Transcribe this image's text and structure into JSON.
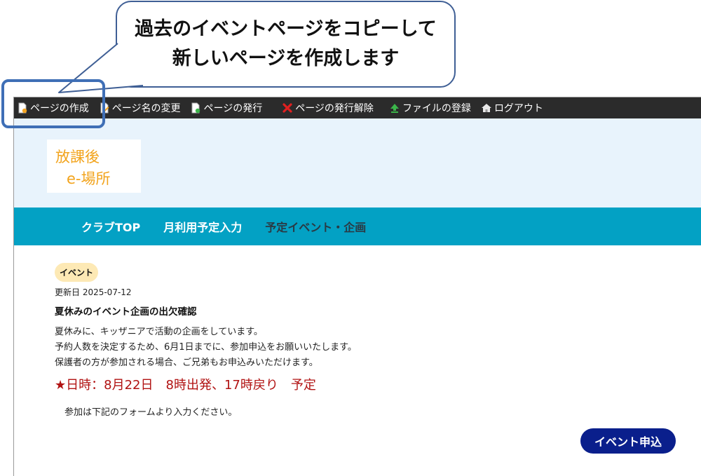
{
  "callout": {
    "line1": "過去のイベントページをコピーして",
    "line2": "新しいページを作成します"
  },
  "toolbar": {
    "items": [
      {
        "label": "ページの作成",
        "icon": "page-add-icon"
      },
      {
        "label": "ページ名の変更",
        "icon": "page-edit-icon"
      },
      {
        "label": "ページの発行",
        "icon": "page-publish-icon"
      },
      {
        "label": "ページの発行解除",
        "icon": "red-x-icon"
      },
      {
        "label": "ファイルの登録",
        "icon": "upload-arrow-icon"
      },
      {
        "label": "ログアウト",
        "icon": "home-icon"
      }
    ]
  },
  "logo": {
    "line1": "放課後",
    "line2": "e-場所"
  },
  "nav": {
    "items": [
      {
        "label": "クラブTOP"
      },
      {
        "label": "月利用予定入力"
      },
      {
        "label": "予定イベント・企画"
      }
    ]
  },
  "article": {
    "badge": "イベント",
    "date": "更新日 2025-07-12",
    "title": "夏休みのイベント企画の出欠確認",
    "body": [
      "夏休みに、キッザニアで活動の企画をしています。",
      "予約人数を決定するため、6月1日までに、参加申込をお願いいたします。",
      "保護者の方が参加される場合、ご兄弟もお申込みいただけます。"
    ],
    "highlight": "★日時：8月22日　8時出発、17時戻り　予定",
    "note": "参加は下記のフォームより入力ください。"
  },
  "apply_button": {
    "label": "イベント申込"
  },
  "colors": {
    "toolbar_bg": "#2b2b2b",
    "hero_bg": "#e8f3fc",
    "nav_bg": "#03a1c4",
    "nav_active": "#ffffff",
    "nav_inactive": "#2a3a44",
    "badge_bg": "#fde9b5",
    "highlight_text": "#b11212",
    "button_bg": "#0a1f8c",
    "callout_border": "#3f5f95"
  }
}
